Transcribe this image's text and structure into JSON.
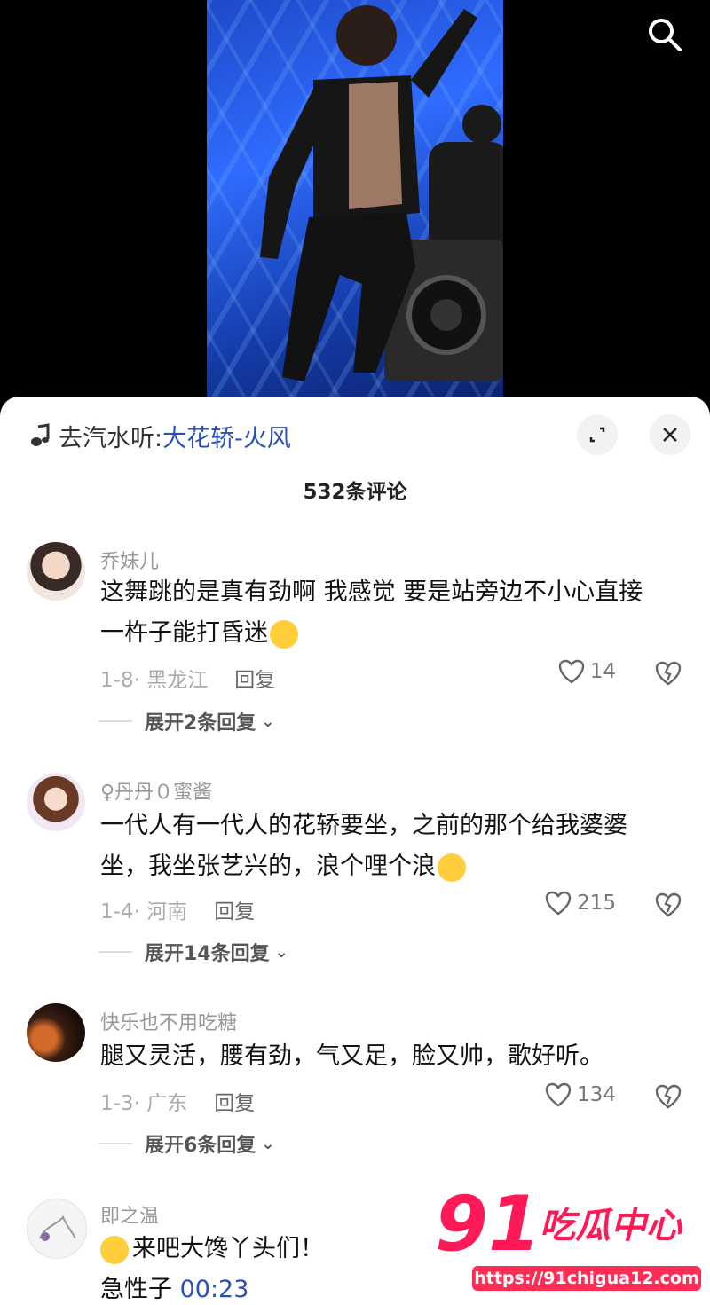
{
  "video": {
    "search_icon": "search-icon"
  },
  "sheet": {
    "music_prefix": "去汽水听:",
    "music_song": "大花轿-火风",
    "comment_count": "532条评论",
    "comments": [
      {
        "user": "乔妹儿",
        "text_line1": "这舞跳的是真有劲啊 我感觉 要是站旁边不小心直接",
        "text_line2": "一杵子能打昏迷",
        "meta": "1-8· 黑龙江",
        "reply": "回复",
        "likes": "14",
        "expand": "展开2条回复"
      },
      {
        "user": "♀丹丹０蜜酱",
        "text_line1": "一代人有一代人的花轿要坐，之前的那个给我婆婆",
        "text_line2": "坐，我坐张艺兴的，浪个哩个浪",
        "meta": "1-4· 河南",
        "reply": "回复",
        "likes": "215",
        "expand": "展开14条回复"
      },
      {
        "user": "快乐也不用吃糖",
        "text_line1": "腿又灵活，腰有劲，气又足，脸又帅，歌好听。",
        "meta": "1-3· 广东",
        "reply": "回复",
        "likes": "134",
        "expand": "展开6条回复"
      },
      {
        "user": "即之温",
        "text_line1": "来吧大馋丫头们！",
        "text_line2_prefix": "急性子 ",
        "text_line2_link": "00:23"
      }
    ]
  },
  "watermark": {
    "logo": "91",
    "name": "吃瓜中心",
    "url": "https://91chigua12.com"
  },
  "colors": {
    "link": "#2a4fb8",
    "watermark": "#ff1a57"
  }
}
